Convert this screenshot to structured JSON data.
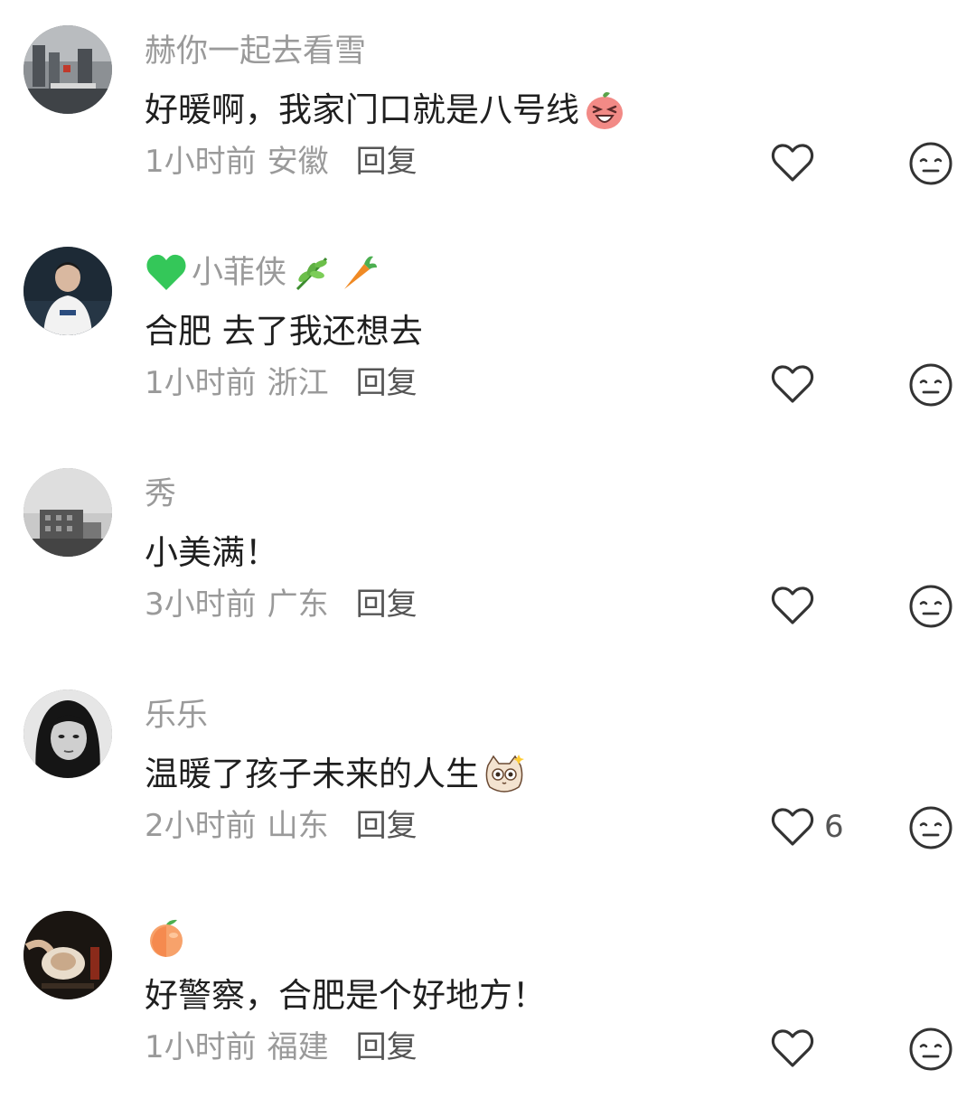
{
  "comments": [
    {
      "name": "赫你一起去看雪",
      "text": "好暖啊，我家门口就是八号线",
      "time": "1小时前",
      "location": "安徽",
      "reply": "回复",
      "likes": "",
      "name_icons": [],
      "text_icons": [
        "laughing-peach-sticker-icon"
      ]
    },
    {
      "name": "小菲侠",
      "text": "合肥 去了我还想去",
      "time": "1小时前",
      "location": "浙江",
      "reply": "回复",
      "likes": "",
      "name_icons": [
        "green-heart-icon",
        "herb-icon",
        "carrot-icon"
      ],
      "text_icons": []
    },
    {
      "name": "秀",
      "text": "小美满！",
      "time": "3小时前",
      "location": "广东",
      "reply": "回复",
      "likes": "",
      "name_icons": [],
      "text_icons": []
    },
    {
      "name": "乐乐",
      "text": "温暖了孩子未来的人生",
      "time": "2小时前",
      "location": "山东",
      "reply": "回复",
      "likes": "6",
      "name_icons": [],
      "text_icons": [
        "cat-sticker-icon"
      ]
    },
    {
      "name": "",
      "text": "好警察，合肥是个好地方！",
      "time": "1小时前",
      "location": "福建",
      "reply": "回复",
      "likes": "",
      "name_icons": [
        "peach-icon"
      ],
      "text_icons": []
    }
  ],
  "colors": {
    "meta_text": "#9a9a9a",
    "body_text": "#1f1f1f",
    "icon_stroke": "#333333"
  }
}
